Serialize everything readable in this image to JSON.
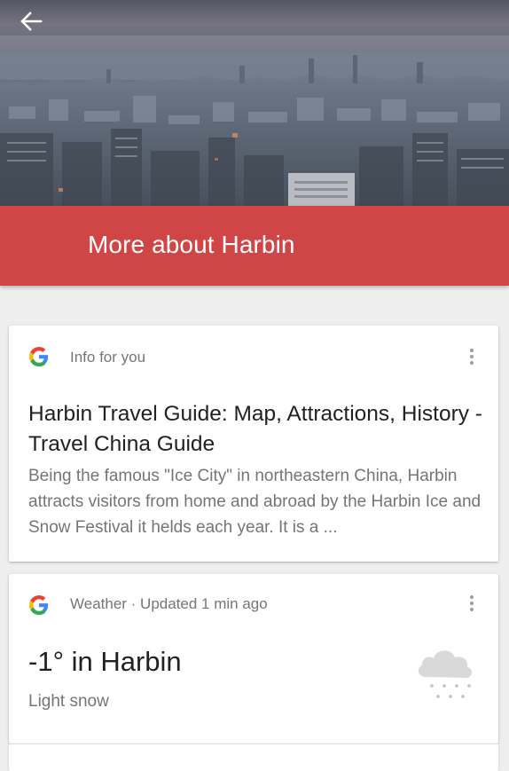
{
  "header": {
    "back_icon": "arrow-left-icon",
    "title": "More about Harbin",
    "title_bar_color": "#d04545"
  },
  "cards": {
    "info": {
      "source_icon": "google-g-icon",
      "label": "Info for you",
      "title": "Harbin Travel Guide: Map, Attractions, History - Travel China Guide",
      "snippet": "Being the famous \"Ice City\" in northeastern China, Harbin attracts visitors from home and abroad by the Harbin Ice and Snow Festival it helds each year. It is a ...",
      "menu_icon": "more-vert-icon"
    },
    "weather": {
      "source_icon": "google-g-icon",
      "label": "Weather · Updated 1 min ago",
      "temperature": "-1° in Harbin",
      "condition": "Light snow",
      "condition_icon": "snow-cloud-icon",
      "menu_icon": "more-vert-icon"
    }
  }
}
